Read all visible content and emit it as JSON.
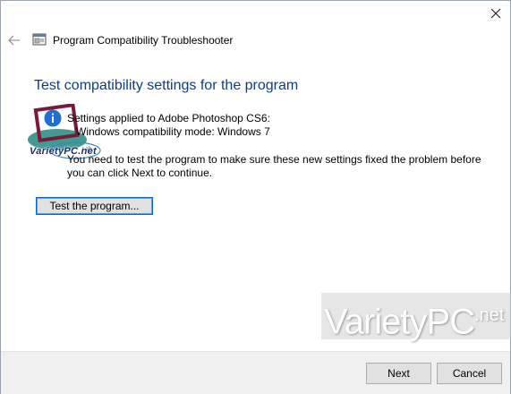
{
  "window": {
    "title": "Program Compatibility Troubleshooter"
  },
  "page": {
    "heading": "Test compatibility settings for the program",
    "settings_applied": "Settings applied to Adobe Photoshop CS6:",
    "compat_mode": "Windows compatibility mode: Windows 7",
    "instruction": "You need to test the program to make sure these new settings fixed the problem before you can click Next to continue.",
    "test_button_label": "Test the program..."
  },
  "footer": {
    "next_label": "Next",
    "cancel_label": "Cancel"
  },
  "watermark": {
    "small_text": "VarietyPC.net",
    "big_text_main": "VarietyPC",
    "big_text_sup": ".net"
  },
  "icons": {
    "close": "close-icon",
    "back": "back-arrow-icon",
    "app": "troubleshooter-icon",
    "info": "info-icon"
  },
  "colors": {
    "heading": "#0a3d91",
    "info_blue": "#1e6fd0",
    "footer_bg": "#f0f0f0",
    "focus_border": "#0a67c9"
  }
}
